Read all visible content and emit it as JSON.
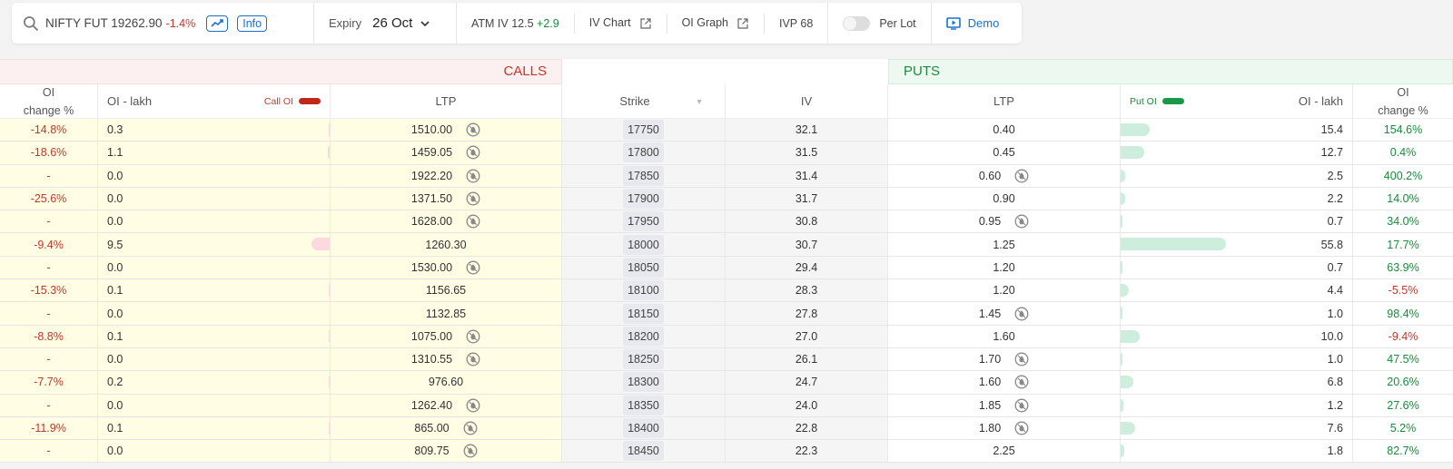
{
  "toolbar": {
    "symbol": "NIFTY FUT 19262.90",
    "symbol_change": "-1.4%",
    "info_label": "Info",
    "expiry_label": "Expiry",
    "expiry_value": "26 Oct",
    "atm_iv_label": "ATM IV 12.5",
    "atm_iv_change": "+2.9",
    "iv_chart_label": "IV Chart",
    "oi_graph_label": "OI Graph",
    "ivp_label": "IVP 68",
    "per_lot_label": "Per Lot",
    "per_lot_on": false,
    "demo_label": "Demo"
  },
  "sections": {
    "calls": "CALLS",
    "puts": "PUTS"
  },
  "headers": {
    "oi_change_line1": "OI",
    "oi_change_line2": "change %",
    "oi_lakh": "OI - lakh",
    "call_oi_legend": "Call OI",
    "put_oi_legend": "Put OI",
    "ltp": "LTP",
    "strike": "Strike",
    "iv": "IV"
  },
  "colors": {
    "call": "#c0392b",
    "put": "#1a8a3c",
    "accent": "#1a6fd0"
  },
  "rows": [
    {
      "c_chg": "-14.8%",
      "c_oi": "0.3",
      "c_oi_frac": 0.005,
      "c_ltp": "1510.00",
      "c_icon": true,
      "strike": "17750",
      "iv": "32.1",
      "p_ltp": "0.40",
      "p_icon": false,
      "p_oi": "15.4",
      "p_oi_frac": 0.276,
      "p_chg": "154.6%",
      "p_chg_sign": "pos"
    },
    {
      "c_chg": "-18.6%",
      "c_oi": "1.1",
      "c_oi_frac": 0.02,
      "c_ltp": "1459.05",
      "c_icon": true,
      "strike": "17800",
      "iv": "31.5",
      "p_ltp": "0.45",
      "p_icon": false,
      "p_oi": "12.7",
      "p_oi_frac": 0.228,
      "p_chg": "0.4%",
      "p_chg_sign": "pos"
    },
    {
      "c_chg": "-",
      "c_oi": "0.0",
      "c_oi_frac": 0,
      "c_ltp": "1922.20",
      "c_icon": true,
      "strike": "17850",
      "iv": "31.4",
      "p_ltp": "0.60",
      "p_icon": true,
      "p_oi": "2.5",
      "p_oi_frac": 0.045,
      "p_chg": "400.2%",
      "p_chg_sign": "pos"
    },
    {
      "c_chg": "-25.6%",
      "c_oi": "0.0",
      "c_oi_frac": 0,
      "c_ltp": "1371.50",
      "c_icon": true,
      "strike": "17900",
      "iv": "31.7",
      "p_ltp": "0.90",
      "p_icon": false,
      "p_oi": "2.2",
      "p_oi_frac": 0.04,
      "p_chg": "14.0%",
      "p_chg_sign": "pos"
    },
    {
      "c_chg": "-",
      "c_oi": "0.0",
      "c_oi_frac": 0,
      "c_ltp": "1628.00",
      "c_icon": true,
      "strike": "17950",
      "iv": "30.8",
      "p_ltp": "0.95",
      "p_icon": true,
      "p_oi": "0.7",
      "p_oi_frac": 0.013,
      "p_chg": "34.0%",
      "p_chg_sign": "pos"
    },
    {
      "c_chg": "-9.4%",
      "c_oi": "9.5",
      "c_oi_frac": 0.17,
      "c_ltp": "1260.30",
      "c_icon": false,
      "strike": "18000",
      "iv": "30.7",
      "p_ltp": "1.25",
      "p_icon": false,
      "p_oi": "55.8",
      "p_oi_frac": 1.0,
      "p_chg": "17.7%",
      "p_chg_sign": "pos"
    },
    {
      "c_chg": "-",
      "c_oi": "0.0",
      "c_oi_frac": 0,
      "c_ltp": "1530.00",
      "c_icon": true,
      "strike": "18050",
      "iv": "29.4",
      "p_ltp": "1.20",
      "p_icon": false,
      "p_oi": "0.7",
      "p_oi_frac": 0.013,
      "p_chg": "63.9%",
      "p_chg_sign": "pos"
    },
    {
      "c_chg": "-15.3%",
      "c_oi": "0.1",
      "c_oi_frac": 0.002,
      "c_ltp": "1156.65",
      "c_icon": false,
      "strike": "18100",
      "iv": "28.3",
      "p_ltp": "1.20",
      "p_icon": false,
      "p_oi": "4.4",
      "p_oi_frac": 0.079,
      "p_chg": "-5.5%",
      "p_chg_sign": "neg"
    },
    {
      "c_chg": "-",
      "c_oi": "0.0",
      "c_oi_frac": 0,
      "c_ltp": "1132.85",
      "c_icon": false,
      "strike": "18150",
      "iv": "27.8",
      "p_ltp": "1.45",
      "p_icon": true,
      "p_oi": "1.0",
      "p_oi_frac": 0.018,
      "p_chg": "98.4%",
      "p_chg_sign": "pos"
    },
    {
      "c_chg": "-8.8%",
      "c_oi": "0.1",
      "c_oi_frac": 0.002,
      "c_ltp": "1075.00",
      "c_icon": true,
      "strike": "18200",
      "iv": "27.0",
      "p_ltp": "1.60",
      "p_icon": false,
      "p_oi": "10.0",
      "p_oi_frac": 0.179,
      "p_chg": "-9.4%",
      "p_chg_sign": "neg"
    },
    {
      "c_chg": "-",
      "c_oi": "0.0",
      "c_oi_frac": 0,
      "c_ltp": "1310.55",
      "c_icon": true,
      "strike": "18250",
      "iv": "26.1",
      "p_ltp": "1.70",
      "p_icon": true,
      "p_oi": "1.0",
      "p_oi_frac": 0.018,
      "p_chg": "47.5%",
      "p_chg_sign": "pos"
    },
    {
      "c_chg": "-7.7%",
      "c_oi": "0.2",
      "c_oi_frac": 0.004,
      "c_ltp": "976.60",
      "c_icon": false,
      "strike": "18300",
      "iv": "24.7",
      "p_ltp": "1.60",
      "p_icon": true,
      "p_oi": "6.8",
      "p_oi_frac": 0.122,
      "p_chg": "20.6%",
      "p_chg_sign": "pos"
    },
    {
      "c_chg": "-",
      "c_oi": "0.0",
      "c_oi_frac": 0,
      "c_ltp": "1262.40",
      "c_icon": true,
      "strike": "18350",
      "iv": "24.0",
      "p_ltp": "1.85",
      "p_icon": true,
      "p_oi": "1.2",
      "p_oi_frac": 0.022,
      "p_chg": "27.6%",
      "p_chg_sign": "pos"
    },
    {
      "c_chg": "-11.9%",
      "c_oi": "0.1",
      "c_oi_frac": 0.002,
      "c_ltp": "865.00",
      "c_icon": true,
      "strike": "18400",
      "iv": "22.8",
      "p_ltp": "1.80",
      "p_icon": true,
      "p_oi": "7.6",
      "p_oi_frac": 0.136,
      "p_chg": "5.2%",
      "p_chg_sign": "pos"
    },
    {
      "c_chg": "-",
      "c_oi": "0.0",
      "c_oi_frac": 0,
      "c_ltp": "809.75",
      "c_icon": true,
      "strike": "18450",
      "iv": "22.3",
      "p_ltp": "2.25",
      "p_icon": false,
      "p_oi": "1.8",
      "p_oi_frac": 0.032,
      "p_chg": "82.7%",
      "p_chg_sign": "pos"
    }
  ]
}
